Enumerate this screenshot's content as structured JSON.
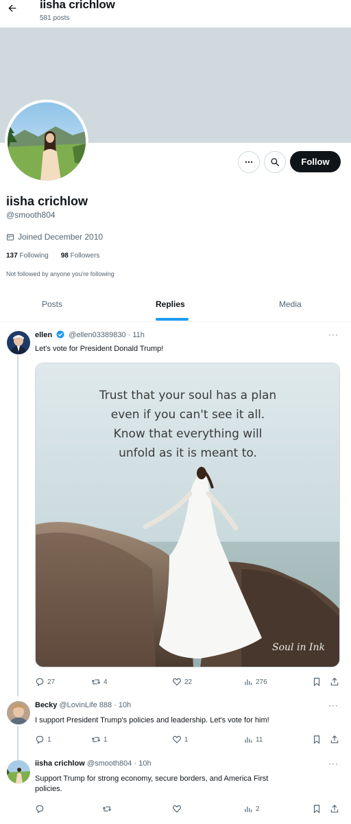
{
  "header": {
    "profile_name": "iisha crichlow",
    "post_count": "581 posts"
  },
  "profile": {
    "display_name": "iisha crichlow",
    "handle": "@smooth804",
    "joined": "Joined December 2010",
    "following_count": "137",
    "following_label": "Following",
    "followers_count": "98",
    "followers_label": "Followers",
    "not_followed_text": "Not followed by anyone you're following",
    "follow_button": "Follow"
  },
  "tabs": [
    {
      "label": "Posts"
    },
    {
      "label": "Replies",
      "active": true
    },
    {
      "label": "Media"
    }
  ],
  "tweets": [
    {
      "name": "ellen",
      "handle": "@ellen03389830",
      "time": "11h",
      "verified": true,
      "text": "Let's vote for President Donald Trump!",
      "image_quote": {
        "line1": "Trust that your soul has a plan",
        "line2": "even if you can't see it all.",
        "line3": "Know that everything will",
        "line4": "unfold as it is meant to.",
        "watermark": "Soul in Ink"
      },
      "replies": "27",
      "reposts": "4",
      "likes": "22",
      "views": "276"
    },
    {
      "name": "Becky",
      "handle": "@LovinLife 888",
      "time": "10h",
      "text": "I support President Trump's policies and leadership. Let's vote for him!",
      "replies": "1",
      "reposts": "1",
      "likes": "1",
      "views": "11"
    },
    {
      "name": "iisha crichlow",
      "handle": "@smooth804",
      "time": "10h",
      "text_line1": "Support Trump for strong economy, secure borders, and America First",
      "text_line2": "policies.",
      "replies": "",
      "reposts": "",
      "likes": "",
      "views": "2"
    }
  ],
  "colors": {
    "accent": "#1d9bf0",
    "banner": "#cfd9de",
    "follow_button_bg": "#0f1419"
  }
}
